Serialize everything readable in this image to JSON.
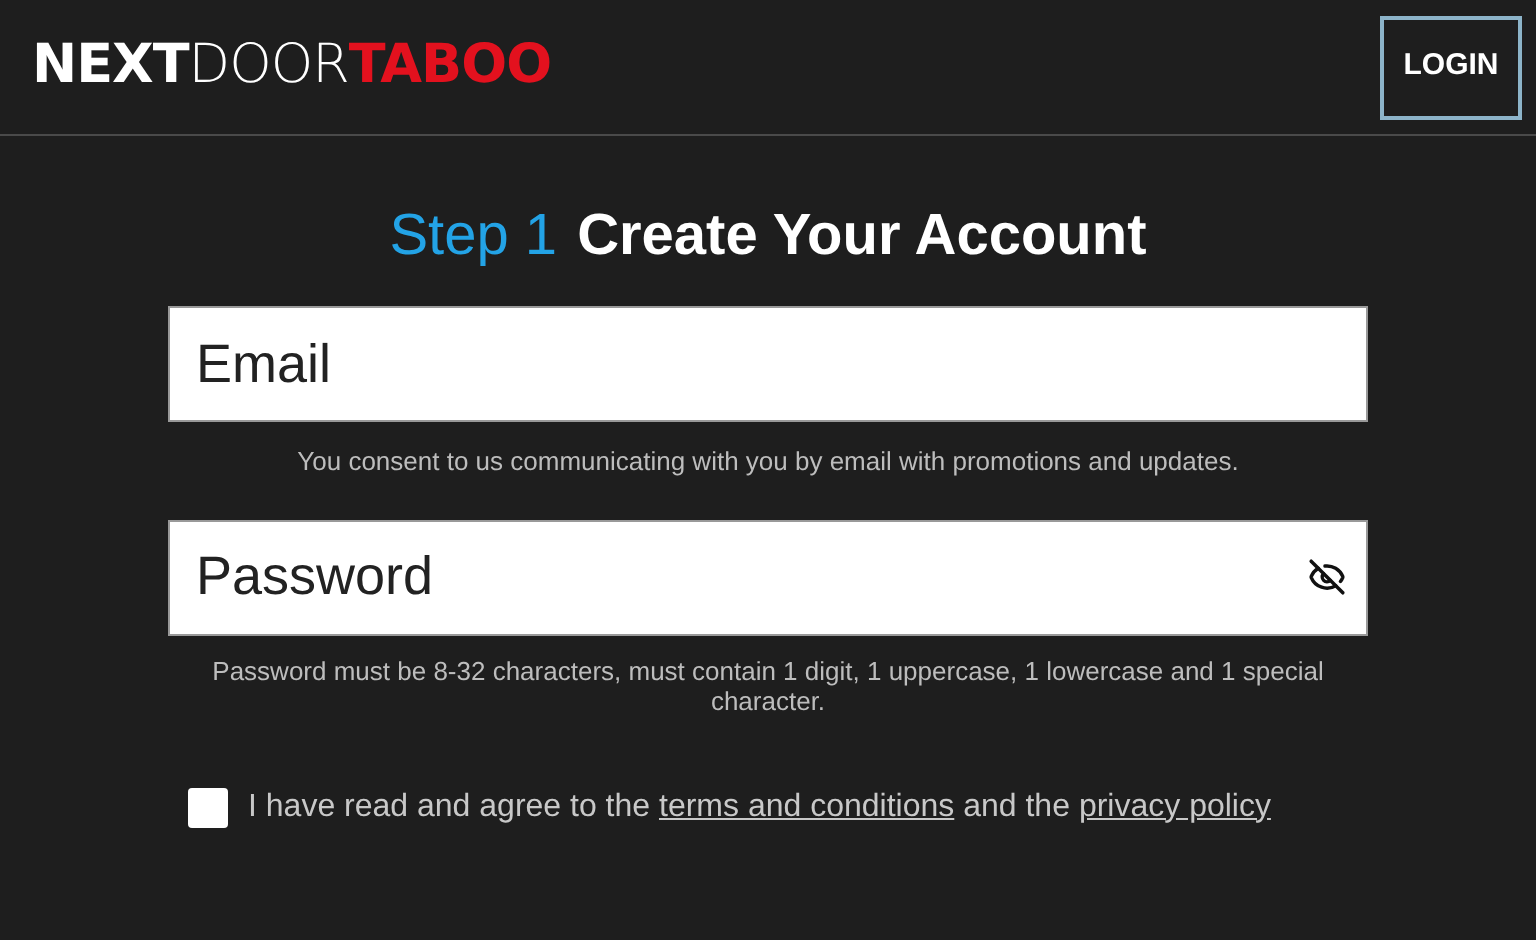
{
  "header": {
    "logo": [
      "NEXT",
      "DOOR",
      "TABOO"
    ],
    "login_button": "LOGIN"
  },
  "step_1": {
    "step": "Step 1",
    "title": "Create Your Account"
  },
  "email": {
    "placeholder": "Email",
    "note": "You consent to us communicating with you by email with promotions and updates."
  },
  "password": {
    "placeholder": "Password",
    "note": "Password must be 8-32 characters, must contain 1 digit, 1 uppercase, 1 lowercase and 1 special character."
  },
  "agreement": {
    "checked": false,
    "parts": [
      {
        "kind": "text",
        "text": "I have read and agree to the"
      },
      {
        "kind": "link",
        "text": "terms and conditions"
      },
      {
        "kind": "text",
        "text": "and the"
      },
      {
        "kind": "link",
        "text": "privacy policy"
      }
    ]
  }
}
